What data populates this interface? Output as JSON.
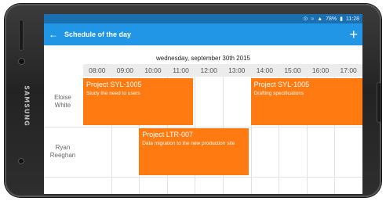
{
  "device": {
    "brand": "SAMSUNG"
  },
  "status_bar": {
    "icons": [
      "network-icon",
      "wifi-icon",
      "signal-icon"
    ],
    "battery": "78%",
    "time": "11:28"
  },
  "appbar": {
    "back_icon": "back-arrow-icon",
    "title": "Schedule of the day",
    "add_icon": "plus-icon"
  },
  "date": "wednesday, september 30th 2015",
  "hours": [
    "08:00",
    "09:00",
    "10:00",
    "11:00",
    "12:00",
    "13:00",
    "14:00",
    "15:00",
    "16:00",
    "17:00"
  ],
  "people": [
    {
      "name_line1": "Eloise",
      "name_line2": "White"
    },
    {
      "name_line1": "Ryan",
      "name_line2": "Reeghan"
    }
  ],
  "events": [
    {
      "project": "Project SYL-1005",
      "desc": "Study the need to users",
      "start": "08:00",
      "end": "12:00",
      "row": 0
    },
    {
      "project": "Project SYL-1005",
      "desc": "Drafting specifications",
      "start": "14:00",
      "end": "18:00",
      "row": 0
    },
    {
      "project": "Project LTR-007",
      "desc": "Data migration to the new production site",
      "start": "10:00",
      "end": "14:00",
      "row": 1
    }
  ],
  "colors": {
    "appbar": "#2196e6",
    "statusbar": "#1a6fb0",
    "event": "#ff7a10"
  }
}
